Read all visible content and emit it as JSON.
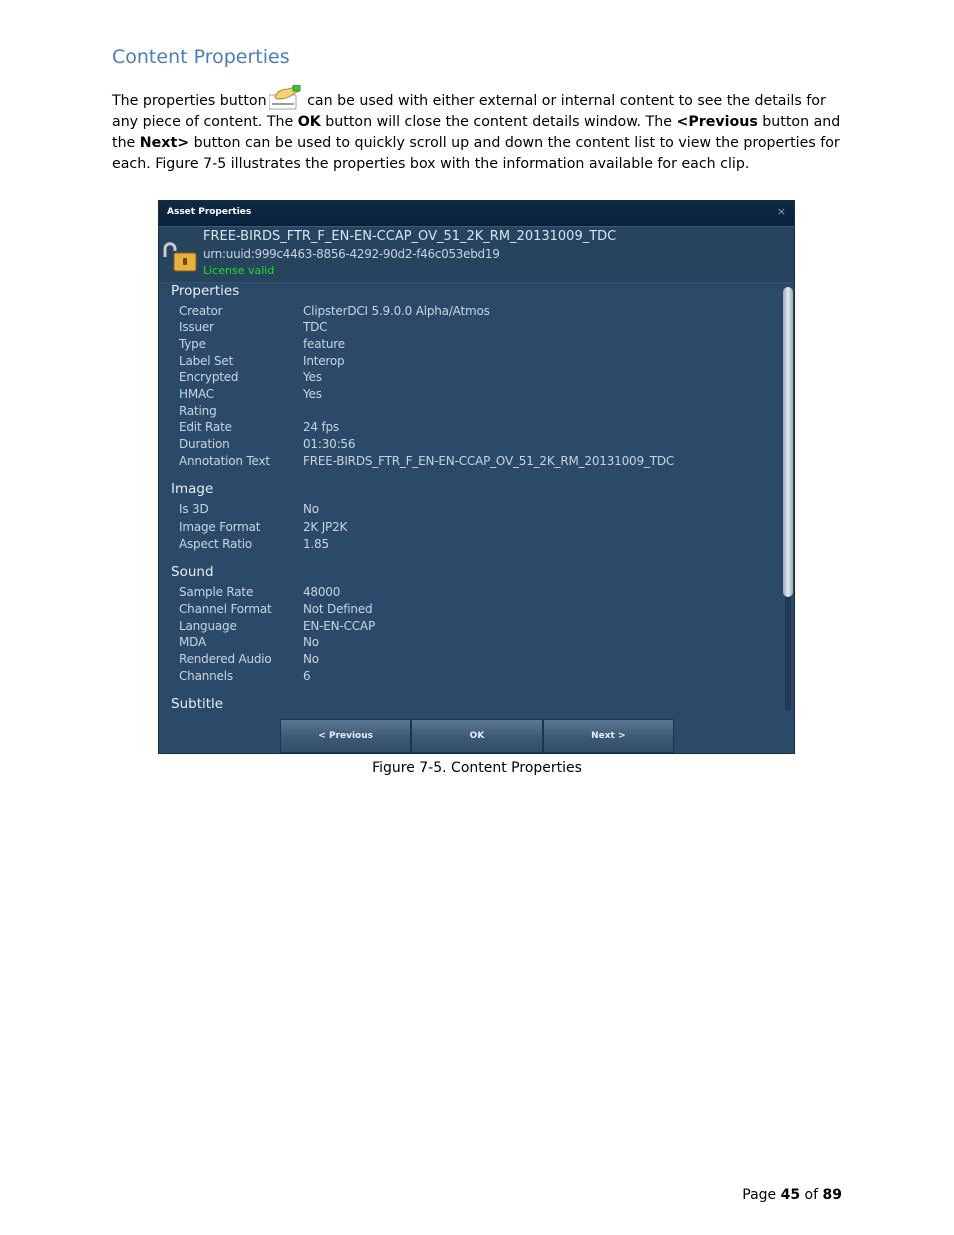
{
  "doc": {
    "heading": "Content Properties",
    "para": {
      "t1": "The properties button",
      "t2": "can be used with either external or internal content to see the details for any piece of content.  The ",
      "ok": "OK",
      "t3": " button  will close the content details window.  The ",
      "prev": "<Previous",
      "t4": " button and the ",
      "next": "Next>",
      "t5": " button can be used to quickly scroll up and down the content list to view the properties for each. Figure 7-5 illustrates the properties box with the information available for each clip."
    },
    "caption": "Figure 7-5.  Content Properties",
    "page": {
      "prefix": "Page ",
      "current": "45",
      "of": " of ",
      "total": "89"
    }
  },
  "window": {
    "title": "Asset Properties",
    "close": "×",
    "asset_name": "FREE-BIRDS_FTR_F_EN-EN-CCAP_OV_51_2K_RM_20131009_TDC",
    "urn": "urn:uuid:999c4463-8856-4292-90d2-f46c053ebd19",
    "license": "License valid",
    "colors": {
      "license": "#22dd22",
      "window_bg": "#2b4a6a",
      "titlebar": "#0f2a47"
    },
    "icons": [
      "lock-icon",
      "properties-hand-icon",
      "close-icon"
    ],
    "sections": {
      "properties": {
        "title": "Properties",
        "rows": [
          {
            "label": "Creator",
            "value": "ClipsterDCI 5.9.0.0 Alpha/Atmos"
          },
          {
            "label": "Issuer",
            "value": "TDC"
          },
          {
            "label": "Type",
            "value": "feature"
          },
          {
            "label": "Label Set",
            "value": "Interop"
          },
          {
            "label": "Encrypted",
            "value": "Yes"
          },
          {
            "label": "HMAC",
            "value": "Yes"
          },
          {
            "label": "Rating",
            "value": ""
          },
          {
            "label": "Edit Rate",
            "value": "24 fps"
          },
          {
            "label": "Duration",
            "value": "01:30:56"
          },
          {
            "label": "Annotation Text",
            "value": "FREE-BIRDS_FTR_F_EN-EN-CCAP_OV_51_2K_RM_20131009_TDC"
          }
        ]
      },
      "image": {
        "title": "Image",
        "rows": [
          {
            "label": "Is 3D",
            "value": "No"
          },
          {
            "label": "Image Format",
            "value": "2K JP2K"
          },
          {
            "label": "Aspect Ratio",
            "value": "1.85"
          }
        ]
      },
      "sound": {
        "title": "Sound",
        "rows": [
          {
            "label": "Sample Rate",
            "value": "48000"
          },
          {
            "label": "Channel Format",
            "value": "Not Defined"
          },
          {
            "label": "Language",
            "value": "EN-EN-CCAP"
          },
          {
            "label": "MDA",
            "value": "No"
          },
          {
            "label": "Rendered Audio",
            "value": "No"
          },
          {
            "label": "Channels",
            "value": "6"
          }
        ]
      },
      "subtitle": {
        "title": "Subtitle"
      }
    },
    "buttons": {
      "previous": "< Previous",
      "ok": "OK",
      "next": "Next >"
    }
  }
}
